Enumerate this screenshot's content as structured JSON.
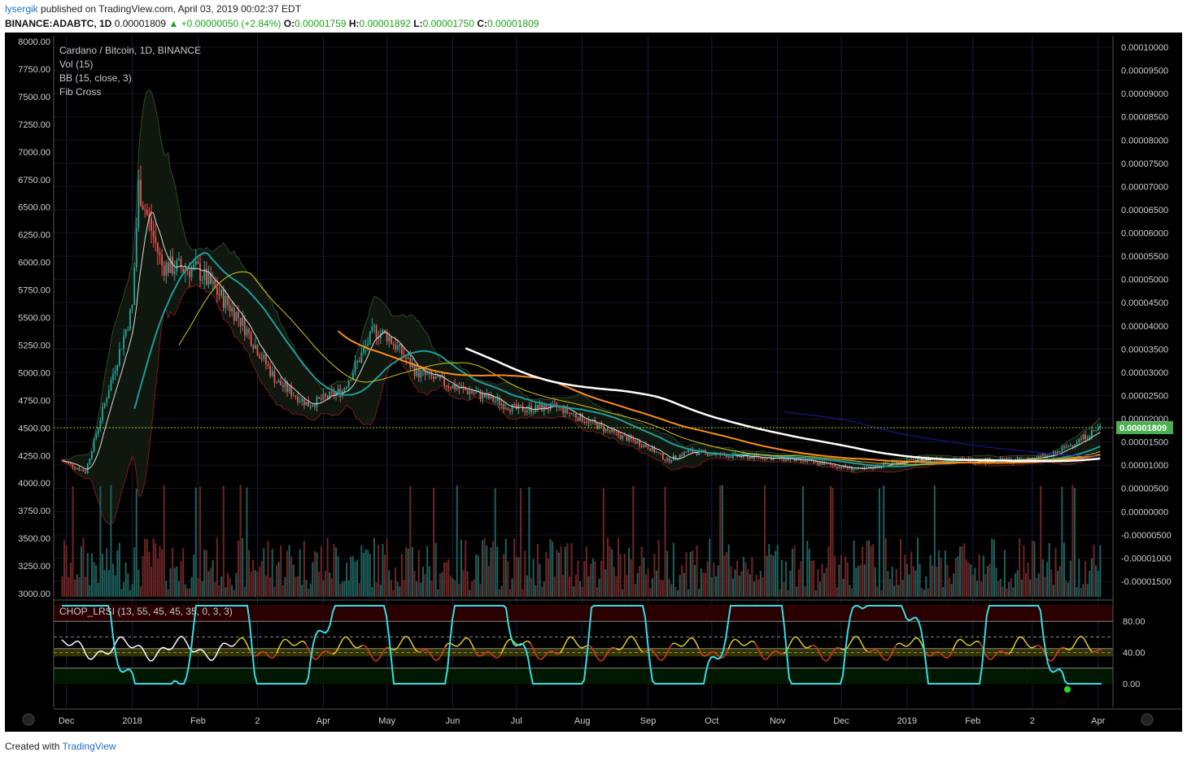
{
  "header": {
    "user": "lysergik",
    "published": "published on TradingView.com, April 03, 2019 00:02:37 EDT",
    "symbol": "BINANCE:ADABTC, 1D",
    "last": "0.00001809",
    "change": "▲ +0.00000050 (+2.84%)",
    "o_label": "O:",
    "o_val": "0.00001759",
    "h_label": "H:",
    "h_val": "0.00001892",
    "l_label": "L:",
    "l_val": "0.00001750",
    "c_label": "C:",
    "c_val": "0.00001809"
  },
  "legend": {
    "pair": "Cardano / Bitcoin, 1D, BINANCE",
    "vol": "Vol (15)",
    "bb": "BB (15, close, 3)",
    "fib": "Fib Cross"
  },
  "subchart": {
    "label": "CHOP_LRSI (13, 55, 45, 45, 35, 0, 3, 3)",
    "ticks": [
      "80.00",
      "40.00",
      "0.00"
    ]
  },
  "footer": {
    "created": "Created with",
    "brand": "TradingView"
  },
  "colors": {
    "background": "#000000",
    "up": "#26a69a",
    "down": "#ef5350",
    "bb_upper": "#2e4a2a",
    "bb_lower": "#7a1a1a",
    "ma_white": "#ffffff",
    "ma_orange": "#ff8c1a",
    "ma_yellow": "#d6c21a",
    "ma_teal": "#1f9c98",
    "ma_navy": "#1a1aa8",
    "lrsi": "#33dde6",
    "price_tag": "#4caf50"
  },
  "chart_data": [
    {
      "type": "candlestick",
      "title": "Cardano / Bitcoin, 1D, BINANCE",
      "x_ticks": [
        "Dec",
        "2018",
        "Feb",
        "2",
        "Apr",
        "May",
        "Jun",
        "Jul",
        "Aug",
        "Sep",
        "Oct",
        "Nov",
        "Dec",
        "2019",
        "Feb",
        "2",
        "Apr"
      ],
      "left_axis_ticks": [
        "8000.00",
        "7750.00",
        "7500.00",
        "7250.00",
        "7000.00",
        "6750.00",
        "6500.00",
        "6250.00",
        "6000.00",
        "5750.00",
        "5500.00",
        "5250.00",
        "5000.00",
        "4750.00",
        "4500.00",
        "4250.00",
        "4000.00",
        "3750.00",
        "3500.00",
        "3250.00",
        "3000.00"
      ],
      "right_axis_ticks": [
        "0.00010000",
        "0.00009500",
        "0.00009000",
        "0.00008500",
        "0.00008000",
        "0.00007500",
        "0.00007000",
        "0.00006500",
        "0.00006000",
        "0.00005500",
        "0.00005000",
        "0.00004500",
        "0.00004000",
        "0.00003500",
        "0.00003000",
        "0.00002500",
        "0.00002000",
        "0.00001500",
        "0.00001000",
        "0.00000500",
        "0.00000000",
        "-0.00000500",
        "-0.00001000",
        "-0.00001500"
      ],
      "last_price": "0.00001809",
      "series": [
        {
          "name": "close",
          "x": [
            "2017-11-29",
            "2017-12-10",
            "2017-12-20",
            "2018-01-01",
            "2018-01-04",
            "2018-01-15",
            "2018-02-01",
            "2018-02-20",
            "2018-03-10",
            "2018-03-25",
            "2018-04-10",
            "2018-04-25",
            "2018-05-01",
            "2018-05-15",
            "2018-06-01",
            "2018-06-15",
            "2018-07-01",
            "2018-07-20",
            "2018-08-01",
            "2018-08-15",
            "2018-09-01",
            "2018-09-10",
            "2018-09-20",
            "2018-10-10",
            "2018-11-01",
            "2018-11-20",
            "2018-12-10",
            "2018-12-25",
            "2019-01-15",
            "2019-02-01",
            "2019-02-20",
            "2019-03-10",
            "2019-03-25",
            "2019-04-02"
          ],
          "values": [
            1.1e-05,
            8.5e-06,
            2.5e-05,
            4.4e-05,
            7e-05,
            5.3e-05,
            5.2e-05,
            4.2e-05,
            2.8e-05,
            2.3e-05,
            2.6e-05,
            3.9e-05,
            3.8e-05,
            3e-05,
            2.7e-05,
            2.5e-05,
            2.2e-05,
            2.25e-05,
            2e-05,
            1.7e-05,
            1.4e-05,
            1.1e-05,
            1.3e-05,
            1.2e-05,
            1.15e-05,
            1.05e-05,
            9e-06,
            1.05e-05,
            1.15e-05,
            1.1e-05,
            1.1e-05,
            1.2e-05,
            1.6e-05,
            1.81e-05
          ]
        }
      ]
    },
    {
      "type": "line",
      "title": "CHOP_LRSI (13, 55, 45, 45, 35, 0, 3, 3)",
      "y_ticks": [
        "80.00",
        "40.00",
        "0.00"
      ],
      "ylim": [
        0,
        100
      ]
    }
  ]
}
